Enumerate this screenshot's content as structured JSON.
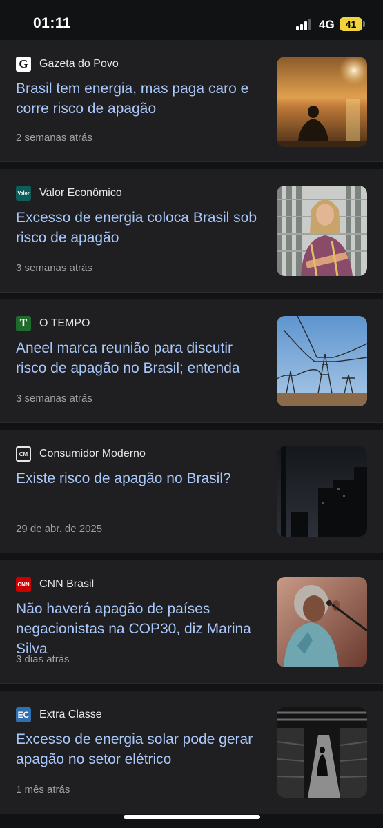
{
  "status_bar": {
    "time": "01:11",
    "network": "4G",
    "battery": "41"
  },
  "articles": [
    {
      "source": "Gazeta do Povo",
      "logo_text": "G",
      "headline": "Brasil tem energia, mas paga caro e corre risco de apagão",
      "age": "2 semanas atrás",
      "image": "sunset-silhouette"
    },
    {
      "source": "Valor Econômico",
      "logo_text": "Valor",
      "headline": "Excesso de energia coloca Brasil sob risco de apagão",
      "age": "3 semanas atrás",
      "image": "woman-portrait"
    },
    {
      "source": "O TEMPO",
      "logo_text": "T",
      "headline": "Aneel marca reunião para discutir risco de apagão no Brasil; entenda",
      "age": "3 semanas atrás",
      "image": "power-towers"
    },
    {
      "source": "Consumidor Moderno",
      "logo_text": "CM",
      "headline": "Existe risco de apagão no Brasil?",
      "age": "29 de abr. de 2025",
      "image": "dark-city"
    },
    {
      "source": "CNN Brasil",
      "logo_text": "CNN",
      "headline": "Não haverá apagão de países negacionistas na COP30, diz Marina Silva",
      "age": "3 dias atrás",
      "image": "speaker-microphone"
    },
    {
      "source": "Extra Classe",
      "logo_text": "EC",
      "headline": "Excesso de energia solar pode gerar apagão no setor elétrico",
      "age": "1 mês atrás",
      "image": "dark-store"
    }
  ]
}
